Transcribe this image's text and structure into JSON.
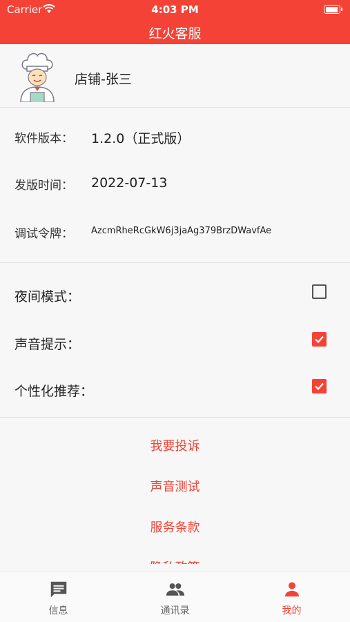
{
  "status_bar": {
    "carrier": "Carrier",
    "time": "4:03 PM"
  },
  "nav": {
    "title": "红火客服"
  },
  "profile": {
    "name": "店铺-张三"
  },
  "info": [
    {
      "label": "软件版本：",
      "value": "1.2.0（正式版）"
    },
    {
      "label": "发版时间：",
      "value": "2022-07-13"
    },
    {
      "label": "调试令牌：",
      "value": "AzcmRheRcGkW6j3jaAg379BrzDWavfAe"
    }
  ],
  "settings": [
    {
      "label": "夜间模式：",
      "checked": false
    },
    {
      "label": "声音提示：",
      "checked": true
    },
    {
      "label": "个性化推荐：",
      "checked": true
    }
  ],
  "links": [
    "我要投诉",
    "声音测试",
    "服务条款",
    "隐私政策"
  ],
  "tabs": [
    {
      "label": "信息",
      "icon": "message-icon",
      "active": false
    },
    {
      "label": "通讯录",
      "icon": "contacts-icon",
      "active": false
    },
    {
      "label": "我的",
      "icon": "person-icon",
      "active": true
    }
  ],
  "colors": {
    "accent": "#f44336",
    "background": "#f7f7f7"
  }
}
